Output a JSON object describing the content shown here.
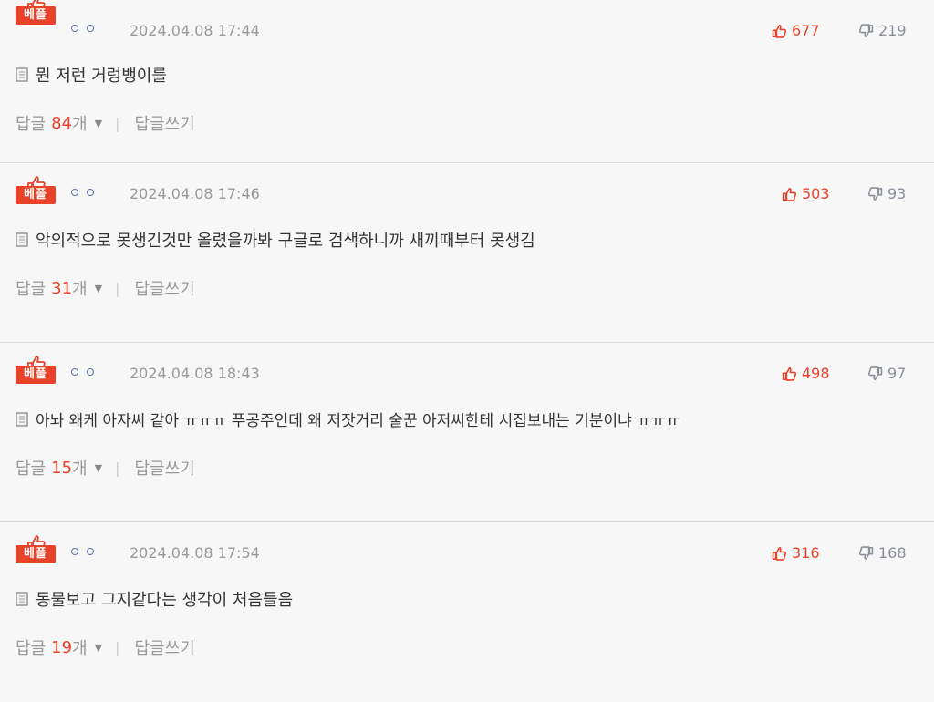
{
  "comments": [
    {
      "badge": "베플",
      "date": "2024.04.08 17:44",
      "likes": "677",
      "dislikes": "219",
      "text": "뭔 저런 거렁뱅이를",
      "reply_label": "답글",
      "reply_count": "84",
      "reply_unit": "개",
      "write_reply": "답글쓰기"
    },
    {
      "badge": "베플",
      "date": "2024.04.08 17:46",
      "likes": "503",
      "dislikes": "93",
      "text": "악의적으로 못생긴것만 올렸을까봐 구글로 검색하니까 새끼때부터 못생김",
      "reply_label": "답글",
      "reply_count": "31",
      "reply_unit": "개",
      "write_reply": "답글쓰기"
    },
    {
      "badge": "베플",
      "date": "2024.04.08 18:43",
      "likes": "498",
      "dislikes": "97",
      "text": "아놔 왜케 아자씨 같아 ㅠㅠㅠ 푸공주인데 왜 저잣거리 술꾼 아저씨한테 시집보내는 기분이냐 ㅠㅠㅠ",
      "reply_label": "답글",
      "reply_count": "15",
      "reply_unit": "개",
      "write_reply": "답글쓰기"
    },
    {
      "badge": "베플",
      "date": "2024.04.08 17:54",
      "likes": "316",
      "dislikes": "168",
      "text": "동물보고 그지같다는 생각이 처음들음",
      "reply_label": "답글",
      "reply_count": "19",
      "reply_unit": "개",
      "write_reply": "답글쓰기"
    }
  ],
  "icons": {
    "best": "thumbs-up-icon",
    "author": "author-circles-icon",
    "like": "like-icon",
    "dislike": "dislike-icon",
    "memo": "memo-icon",
    "caret": "caret-down-icon"
  },
  "colors": {
    "accent": "#e8422b",
    "muted": "#999999",
    "text": "#333333",
    "author": "#5c6fa8"
  }
}
